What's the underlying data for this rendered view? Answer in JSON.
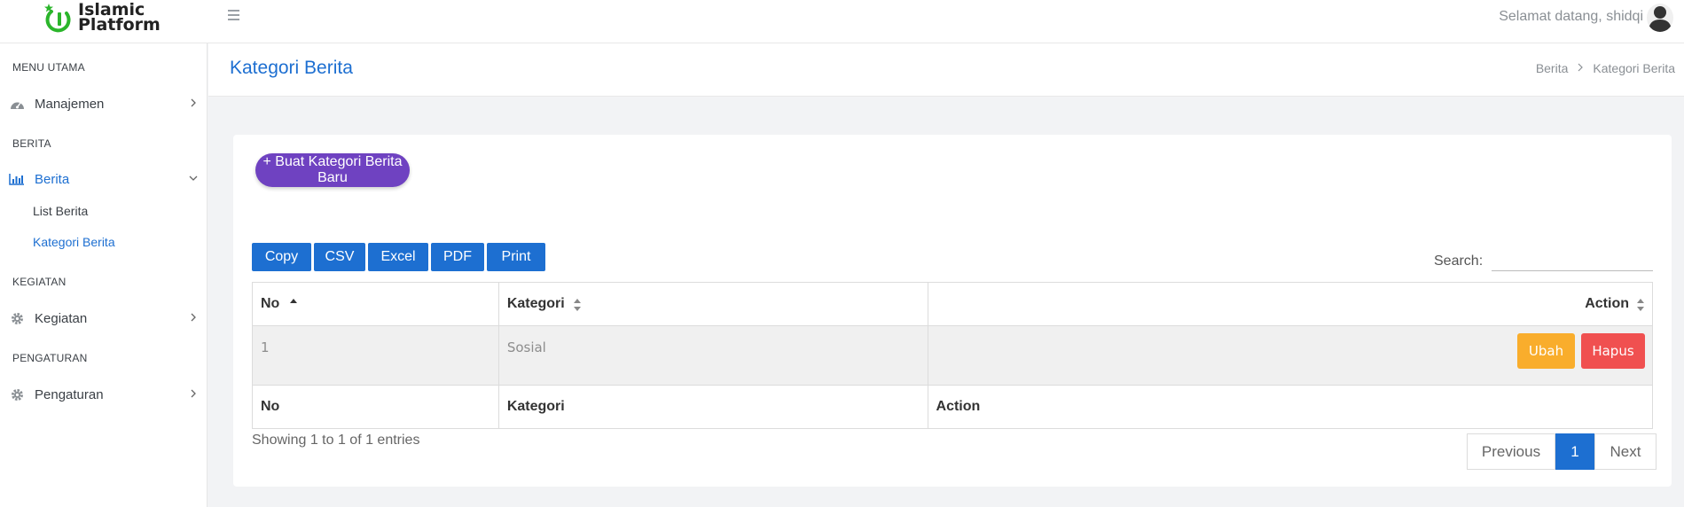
{
  "app": {
    "logo_line1": "Islamic",
    "logo_line2": "Platform",
    "welcome": "Selamat datang, shidqi"
  },
  "sidebar": {
    "sections": [
      {
        "title": "MENU UTAMA"
      },
      {
        "title": "BERITA"
      },
      {
        "title": "KEGIATAN"
      },
      {
        "title": "PENGATURAN"
      }
    ],
    "items": [
      {
        "label": "Manajemen",
        "icon": "dashboard-icon"
      },
      {
        "label": "Berita",
        "icon": "bar-chart-icon"
      },
      {
        "label": "Kegiatan",
        "icon": "gear-icon"
      },
      {
        "label": "Pengaturan",
        "icon": "gear-icon"
      }
    ],
    "subitems": [
      {
        "label": "List Berita"
      },
      {
        "label": "Kategori Berita"
      }
    ]
  },
  "page": {
    "title": "Kategori Berita",
    "breadcrumb": [
      "Berita",
      "Kategori Berita"
    ]
  },
  "actions": {
    "new_label": "+ Buat Kategori Berita Baru"
  },
  "export_buttons": [
    "Copy",
    "CSV",
    "Excel",
    "PDF",
    "Print"
  ],
  "search": {
    "label": "Search:",
    "value": ""
  },
  "table": {
    "headers": [
      "No",
      "Kategori",
      "Action"
    ],
    "rows": [
      {
        "no": "1",
        "kategori": "Sosial",
        "edit_label": "Ubah",
        "delete_label": "Hapus"
      }
    ],
    "footers": [
      "No",
      "Kategori",
      "Action"
    ]
  },
  "pagination": {
    "info": "Showing 1 to 1 of 1 entries",
    "previous": "Previous",
    "current": "1",
    "next": "Next"
  },
  "colors": {
    "primary": "#1d6fd1",
    "purple": "#6f42c1",
    "warning": "#f9ad2c",
    "danger": "#f05050"
  }
}
